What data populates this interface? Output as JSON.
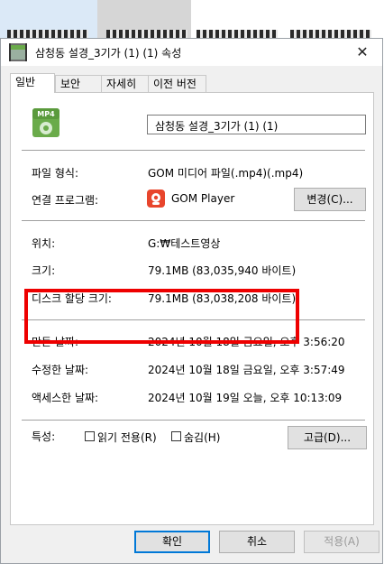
{
  "window": {
    "title": "삼청동 설경_3기가 (1) (1) 속성",
    "close_glyph": "✕"
  },
  "tabs": [
    {
      "label": "일반",
      "active": true
    },
    {
      "label": "보안",
      "active": false
    },
    {
      "label": "자세히",
      "active": false
    },
    {
      "label": "이전 버전",
      "active": false
    }
  ],
  "file": {
    "icon_badge": "MP4",
    "name": "삼청동 설경_3기가 (1) (1)"
  },
  "info": {
    "type_label": "파일 형식:",
    "type_value": "GOM 미디어 파일(.mp4)(.mp4)",
    "opens_label": "연결 프로그램:",
    "opens_value": "GOM Player",
    "change_button": "변경(C)...",
    "location_label": "위치:",
    "location_value": "G:₩테스트영상",
    "size_label": "크기:",
    "size_value": "79.1MB (83,035,940 바이트)",
    "disk_size_label": "디스크 할당 크기:",
    "disk_size_value": "79.1MB (83,038,208 바이트)",
    "created_label": "만든 날짜:",
    "created_value": "2024년 10월 18일 금요일, 오후 3:56:20",
    "modified_label": "수정한 날짜:",
    "modified_value": "2024년 10월 18일 금요일, 오후 3:57:49",
    "accessed_label": "액세스한 날짜:",
    "accessed_value": "2024년 10월 19일 오늘, 오후 10:13:09",
    "attributes_label": "특성:",
    "readonly_label": "읽기 전용(R)",
    "hidden_label": "숨김(H)",
    "advanced_button": "고급(D)..."
  },
  "footer": {
    "ok": "확인",
    "cancel": "취소",
    "apply": "적용(A)"
  },
  "colors": {
    "highlight": "#ee0000",
    "primary_border": "#0078d7",
    "mp4_green": "#6aab4a",
    "gom_red": "#e8452c"
  }
}
